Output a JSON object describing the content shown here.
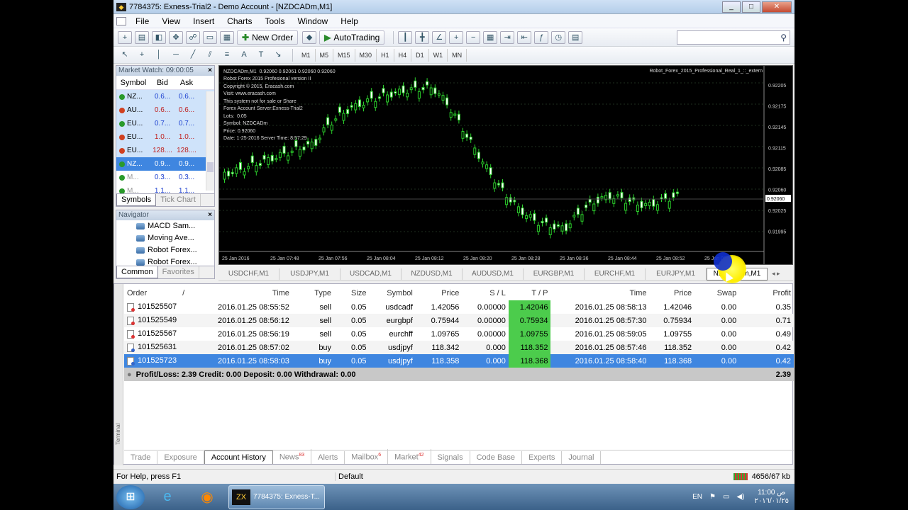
{
  "window": {
    "title": "7784375: Exness-Trial2 - Demo Account - [NZDCADm,M1]",
    "controls": [
      "_",
      "□",
      "✕"
    ]
  },
  "menu": [
    "File",
    "View",
    "Insert",
    "Charts",
    "Tools",
    "Window",
    "Help"
  ],
  "toolbar": {
    "new_order": "New Order",
    "auto_trading": "AutoTrading"
  },
  "timeframes": [
    "M1",
    "M5",
    "M15",
    "M30",
    "H1",
    "H4",
    "D1",
    "W1",
    "MN"
  ],
  "market_watch": {
    "title": "Market Watch: 09:00:05",
    "columns": [
      "Symbol",
      "Bid",
      "Ask"
    ],
    "rows": [
      {
        "symbol": "NZ...",
        "bid": "0.6...",
        "ask": "0.6...",
        "dir": "up"
      },
      {
        "symbol": "AU...",
        "bid": "0.6...",
        "ask": "0.6...",
        "dir": "down"
      },
      {
        "symbol": "EU...",
        "bid": "0.7...",
        "ask": "0.7...",
        "dir": "up"
      },
      {
        "symbol": "EU...",
        "bid": "1.0...",
        "ask": "1.0...",
        "dir": "down"
      },
      {
        "symbol": "EU...",
        "bid": "128....",
        "ask": "128....",
        "dir": "down"
      },
      {
        "symbol": "NZ...",
        "bid": "0.9...",
        "ask": "0.9...",
        "dir": "up"
      },
      {
        "symbol": "M...",
        "bid": "0.3...",
        "ask": "0.3...",
        "dir": "up"
      },
      {
        "symbol": "M...",
        "bid": "1.1...",
        "ask": "1.1...",
        "dir": "up"
      }
    ],
    "tabs": [
      "Symbols",
      "Tick Chart"
    ]
  },
  "navigator": {
    "title": "Navigator",
    "items": [
      "MACD Sam...",
      "Moving Ave...",
      "Robot Forex...",
      "Robot Forex..."
    ],
    "tabs": [
      "Common",
      "Favorites"
    ]
  },
  "chart": {
    "header": "NZDCADm,M1  0.92060 0.92061 0.92060 0.92060",
    "info": "Robot Forex 2015 Profesional version II\nCopyright © 2015, Eracash.com\nVisit: www.eracash.com\nThis system not for sale or Share\nForex Account Server:Exness-Trial2\nLots:  0.05\nSymbol: NZDCADm\nPrice: 0.92060\nDate: 1-25-2016 Server Time: 8:57:29",
    "ea_name": "Robot_Forex_2015_Professional_Real_1_::_extern",
    "price_labels": [
      "0.92205",
      "0.92175",
      "0.92145",
      "0.92115",
      "0.92085",
      "0.92060",
      "0.92025",
      "0.91995"
    ],
    "time_labels": [
      "25 Jan 2016",
      "25 Jan 07:48",
      "25 Jan 07:56",
      "25 Jan 08:04",
      "25 Jan 08:12",
      "25 Jan 08:20",
      "25 Jan 08:28",
      "25 Jan 08:36",
      "25 Jan 08:44",
      "25 Jan 08:52",
      "25 Jan 09:00"
    ]
  },
  "chart_tabs": [
    "USDCHF,M1",
    "USDJPY,M1",
    "USDCAD,M1",
    "NZDUSD,M1",
    "AUDUSD,M1",
    "EURGBP,M1",
    "EURCHF,M1",
    "EURJPY,M1",
    "NZDCADm,M1"
  ],
  "terminal": {
    "side_label": "Terminal",
    "columns": [
      "Order",
      "/",
      "Time",
      "Type",
      "Size",
      "Symbol",
      "Price",
      "S / L",
      "T / P",
      "Time",
      "Price",
      "Swap",
      "Profit"
    ],
    "rows": [
      {
        "order": "101525507",
        "time": "2016.01.25 08:55:52",
        "type": "sell",
        "size": "0.05",
        "symbol": "usdcadf",
        "price": "1.42056",
        "sl": "0.00000",
        "tp": "1.42046",
        "ctime": "2016.01.25 08:58:13",
        "cprice": "1.42046",
        "swap": "0.00",
        "profit": "0.35"
      },
      {
        "order": "101525549",
        "time": "2016.01.25 08:56:12",
        "type": "sell",
        "size": "0.05",
        "symbol": "eurgbpf",
        "price": "0.75944",
        "sl": "0.00000",
        "tp": "0.75934",
        "ctime": "2016.01.25 08:57:30",
        "cprice": "0.75934",
        "swap": "0.00",
        "profit": "0.71"
      },
      {
        "order": "101525567",
        "time": "2016.01.25 08:56:19",
        "type": "sell",
        "size": "0.05",
        "symbol": "eurchff",
        "price": "1.09765",
        "sl": "0.00000",
        "tp": "1.09755",
        "ctime": "2016.01.25 08:59:05",
        "cprice": "1.09755",
        "swap": "0.00",
        "profit": "0.49"
      },
      {
        "order": "101525631",
        "time": "2016.01.25 08:57:02",
        "type": "buy",
        "size": "0.05",
        "symbol": "usdjpyf",
        "price": "118.342",
        "sl": "0.000",
        "tp": "118.352",
        "ctime": "2016.01.25 08:57:46",
        "cprice": "118.352",
        "swap": "0.00",
        "profit": "0.42"
      },
      {
        "order": "101525723",
        "time": "2016.01.25 08:58:03",
        "type": "buy",
        "size": "0.05",
        "symbol": "usdjpyf",
        "price": "118.358",
        "sl": "0.000",
        "tp": "118.368",
        "ctime": "2016.01.25 08:58:40",
        "cprice": "118.368",
        "swap": "0.00",
        "profit": "0.42"
      }
    ],
    "summary": "Profit/Loss: 2.39  Credit: 0.00  Deposit: 0.00  Withdrawal: 0.00",
    "total": "2.39",
    "tabs": [
      {
        "label": "Trade",
        "badge": ""
      },
      {
        "label": "Exposure",
        "badge": ""
      },
      {
        "label": "Account History",
        "badge": ""
      },
      {
        "label": "News",
        "badge": "83"
      },
      {
        "label": "Alerts",
        "badge": ""
      },
      {
        "label": "Mailbox",
        "badge": "6"
      },
      {
        "label": "Market",
        "badge": "42"
      },
      {
        "label": "Signals",
        "badge": ""
      },
      {
        "label": "Code Base",
        "badge": ""
      },
      {
        "label": "Experts",
        "badge": ""
      },
      {
        "label": "Journal",
        "badge": ""
      }
    ]
  },
  "status": {
    "help": "For Help, press F1",
    "profile": "Default",
    "traffic": "4656/67 kb"
  },
  "taskbar": {
    "active": "7784375: Exness-T...",
    "lang": "EN",
    "time": "11:00 ص",
    "date": "٢٠١٦/٠١/٢٥"
  }
}
